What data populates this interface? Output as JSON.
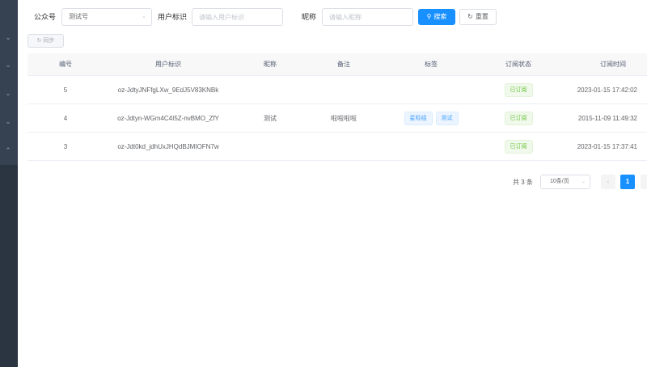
{
  "sidebar": {
    "icons": [
      "chevron-down-icon",
      "chevron-down-icon",
      "chevron-down-icon",
      "chevron-down-icon",
      "chevron-up-icon"
    ]
  },
  "search": {
    "account_label": "公众号",
    "account_value": "测试号",
    "openid_label": "用户标识",
    "openid_placeholder": "请输入用户标识",
    "nickname_label": "昵称",
    "nickname_placeholder": "请输入昵称",
    "search_button": "搜索",
    "reset_button": "重置"
  },
  "toolbar": {
    "sync_button": "同步"
  },
  "table": {
    "headers": [
      "编号",
      "用户标识",
      "昵称",
      "备注",
      "标签",
      "订阅状态",
      "订阅时间"
    ],
    "rows": [
      {
        "id": "5",
        "openid": "oz-JdtyJNFfgLXw_9EdJ5V83KNBk",
        "nickname": "",
        "remark": "",
        "tags": [],
        "status": "已订阅",
        "time": "2023-01-15 17:42:02"
      },
      {
        "id": "4",
        "openid": "oz-Jdtyn-WGm4C4I5Z-nvBMO_ZfY",
        "nickname": "测试",
        "remark": "啦啦啦啦",
        "tags": [
          "星标组",
          "测试"
        ],
        "status": "已订阅",
        "time": "2015-11-09 11:49:32"
      },
      {
        "id": "3",
        "openid": "oz-Jdt0kd_jdhUxJHQdBJMIOFN7w",
        "nickname": "",
        "remark": "",
        "tags": [],
        "status": "已订阅",
        "time": "2023-01-15 17:37:41"
      }
    ]
  },
  "pagination": {
    "total_text": "共 3 条",
    "page_size": "10条/页",
    "current_page": "1"
  },
  "colors": {
    "primary": "#1890ff",
    "sidebar": "#2b3441",
    "success": "#67c23a"
  }
}
